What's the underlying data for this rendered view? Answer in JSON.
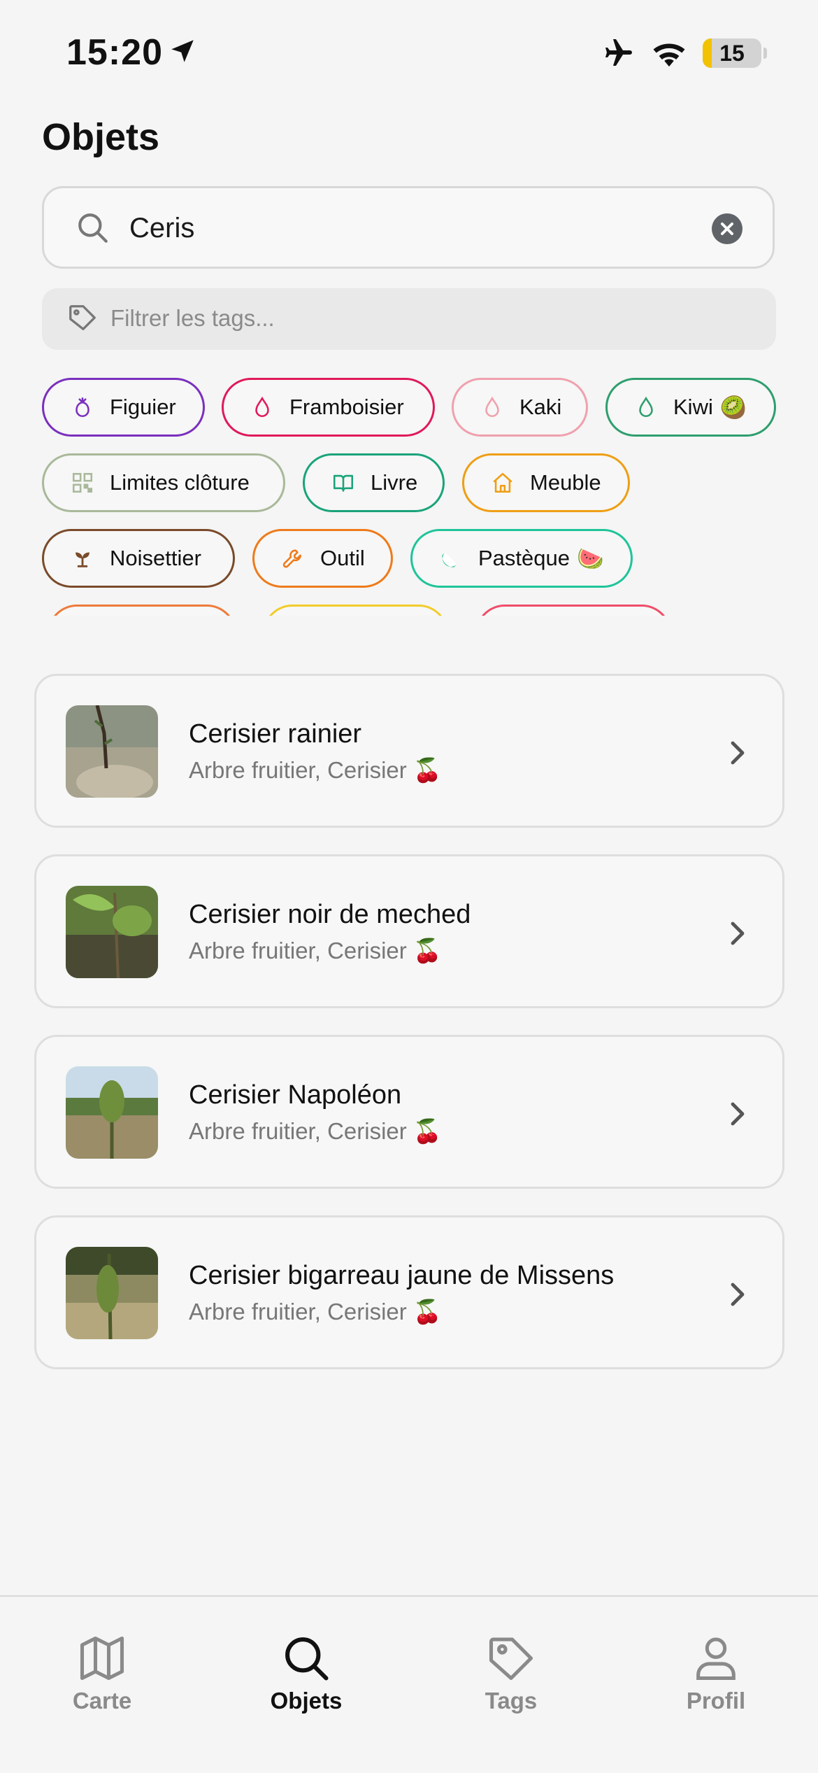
{
  "status_bar": {
    "time": "15:20",
    "battery": "15"
  },
  "page_title": "Objets",
  "search": {
    "value": "Ceris"
  },
  "tag_filter": {
    "placeholder": "Filtrer les tags..."
  },
  "tags": [
    {
      "label": "Figuier",
      "icon": "fig-icon",
      "color": "#7b2fbe",
      "emoji": ""
    },
    {
      "label": "Framboisier",
      "icon": "drop-icon",
      "color": "#e0195a",
      "emoji": ""
    },
    {
      "label": "Kaki",
      "icon": "drop-icon",
      "color": "#f0a0ae",
      "emoji": ""
    },
    {
      "label": "Kiwi",
      "icon": "drop-icon",
      "color": "#2e9e6e",
      "emoji": "🥝"
    },
    {
      "label": "Limites clôture",
      "icon": "qr-icon",
      "color": "#a9b89a",
      "emoji": ""
    },
    {
      "label": "Livre",
      "icon": "book-icon",
      "color": "#1aa37a",
      "emoji": ""
    },
    {
      "label": "Meuble",
      "icon": "house-icon",
      "color": "#ef9e14",
      "emoji": ""
    },
    {
      "label": "Noisettier",
      "icon": "sprout-icon",
      "color": "#7a4a2a",
      "emoji": ""
    },
    {
      "label": "Outil",
      "icon": "wrench-icon",
      "color": "#ef7a1a",
      "emoji": ""
    },
    {
      "label": "Pastèque",
      "icon": "watermelon-icon",
      "color": "#1fc49a",
      "emoji": "🍉"
    },
    {
      "label": "",
      "icon": "",
      "color": "#ef7a3a",
      "emoji": ""
    },
    {
      "label": "",
      "icon": "",
      "color": "#f2cc2a",
      "emoji": ""
    },
    {
      "label": "",
      "icon": "",
      "color": "#ef4d6a",
      "emoji": ""
    }
  ],
  "results": [
    {
      "title": "Cerisier rainier",
      "subtitle": "Arbre fruitier, Cerisier 🍒"
    },
    {
      "title": "Cerisier noir de meched",
      "subtitle": "Arbre fruitier, Cerisier 🍒"
    },
    {
      "title": "Cerisier Napoléon",
      "subtitle": "Arbre fruitier, Cerisier 🍒"
    },
    {
      "title": "Cerisier bigarreau jaune de Missens",
      "subtitle": "Arbre fruitier, Cerisier 🍒"
    }
  ],
  "tab_bar": {
    "tabs": [
      {
        "label": "Carte",
        "icon": "map-icon"
      },
      {
        "label": "Objets",
        "icon": "search-icon"
      },
      {
        "label": "Tags",
        "icon": "tag-icon"
      },
      {
        "label": "Profil",
        "icon": "person-icon"
      }
    ],
    "active": "Objets"
  }
}
